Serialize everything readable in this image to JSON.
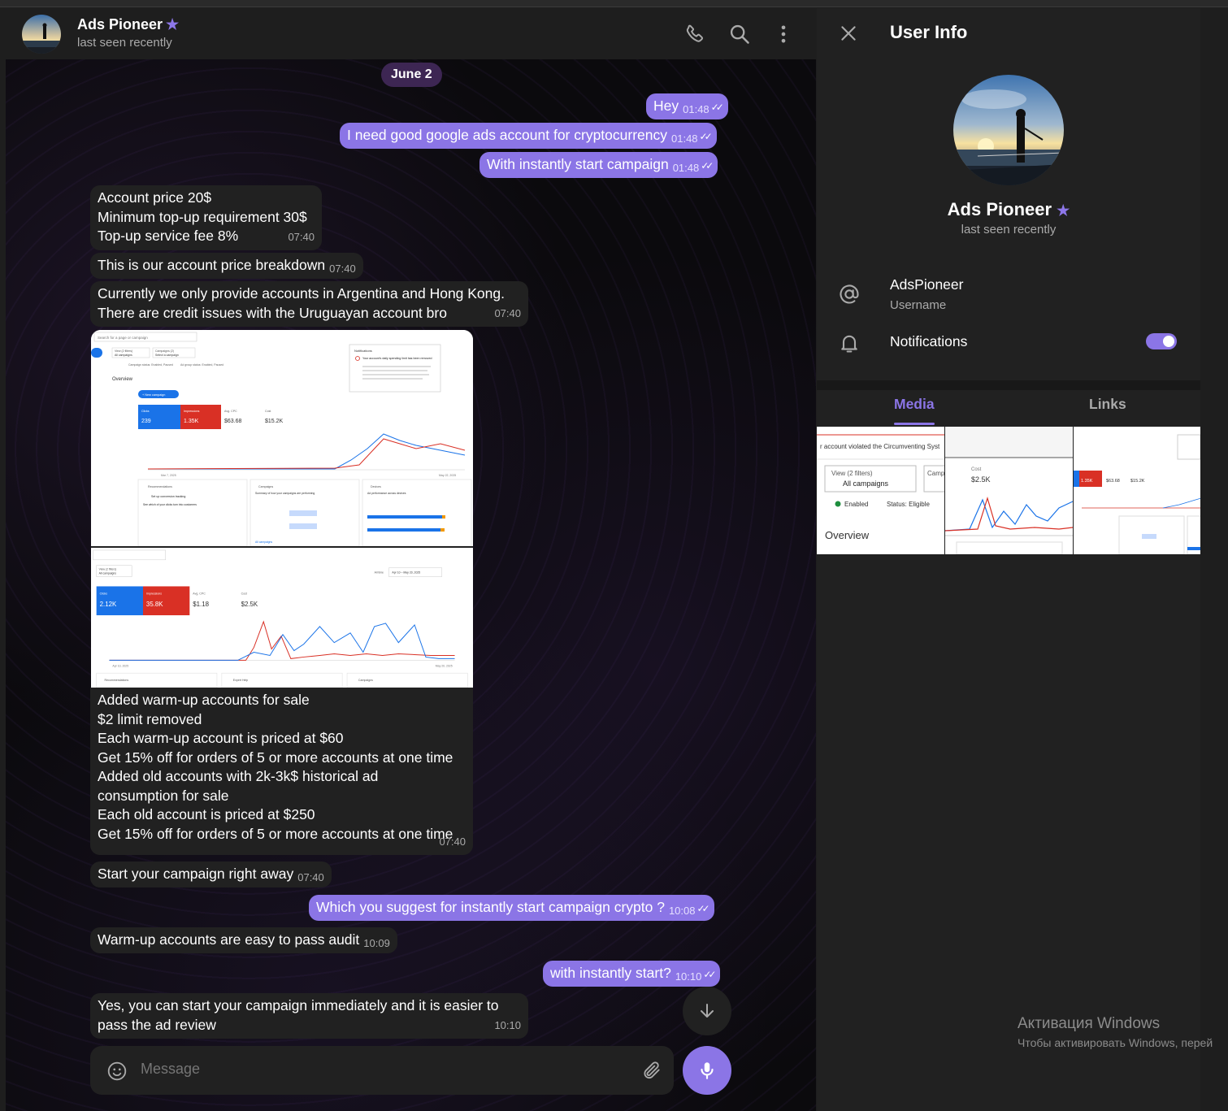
{
  "header": {
    "name": "Ads Pioneer",
    "status": "last seen recently"
  },
  "date_divider": "June 2",
  "messages": [
    {
      "dir": "out",
      "text": "Hey",
      "time": "01:48"
    },
    {
      "dir": "out",
      "text": "I need good google ads account for cryptocurrency",
      "time": "01:48"
    },
    {
      "dir": "out",
      "text": "With instantly start campaign",
      "time": "01:48"
    },
    {
      "dir": "in",
      "lines": [
        "Account price 20$",
        "Minimum top-up requirement 30$",
        "Top-up service fee 8%"
      ],
      "time": "07:40"
    },
    {
      "dir": "in",
      "text": "This is our account price breakdown",
      "time": "07:40"
    },
    {
      "dir": "in",
      "lines": [
        "Currently we only provide accounts in Argentina and Hong Kong.",
        "There are credit issues with the Uruguayan account bro"
      ],
      "time": "07:40"
    },
    {
      "dir": "in",
      "lines": [
        "Added warm-up accounts for sale",
        "$2 limit removed",
        "Each warm-up account is priced at $60",
        "Get 15% off for orders of 5 or more accounts at one time",
        "Added old accounts with 2k-3k$ historical ad",
        "consumption for sale",
        "Each old account is priced at $250",
        "Get 15% off for orders of 5 or more accounts at one time"
      ],
      "time": "07:40"
    },
    {
      "dir": "in",
      "text": "Start your campaign right away",
      "time": "07:40"
    },
    {
      "dir": "out",
      "text": "Which you suggest for instantly start campaign crypto ?",
      "time": "10:08"
    },
    {
      "dir": "in",
      "text": "Warm-up accounts are easy to pass audit",
      "time": "10:09"
    },
    {
      "dir": "out",
      "text": "with instantly start?",
      "time": "10:10"
    },
    {
      "dir": "in",
      "lines": [
        "Yes, you can start your campaign immediately and it is easier to",
        "pass the ad review"
      ],
      "time": "10:10"
    }
  ],
  "screenshot1": {
    "search": "Search for a page or campaign",
    "view": "View (2 filters)",
    "view_sub": "All campaigns",
    "campaigns": "Campaigns (2)",
    "campaigns_sub": "Select a campaign",
    "filters": "Campaign status: Enabled, Paused",
    "filters2": "Ad group status: Enabled, Paused",
    "overview": "Overview",
    "new_campaign": "+ New campaign",
    "clicks_label": "Clicks",
    "clicks": "239",
    "impressions_label": "Impressions",
    "impressions": "1.35K",
    "cpc_label": "Avg. CPC",
    "cpc": "$63.68",
    "cost_label": "Cost",
    "cost": "$15.2K",
    "notif_title": "Notifications",
    "notif_head": "Your account's daily spending limit has been removed",
    "notif_body": "Your account's daily spending limit has been removed. Your daily spend will now be based on the budgets you've set for your campaigns",
    "recs": "Recommendations",
    "rec_item": "Set up conversion tracking",
    "rec_sub": "See which of your clicks turn into customers",
    "camp_panel": "Campaigns",
    "camp_sub": "Summary of how your campaigns are performing",
    "devices": "Devices",
    "devices_sub": "Ad performance across devices",
    "all_campaigns": "All campaigns",
    "chart_left": "Mar 7, 2025",
    "chart_right": "May 22, 2025"
  },
  "screenshot2": {
    "view": "View (2 filters)",
    "view_sub": "All campaigns",
    "range": "Apr 10 – May 20, 2025",
    "range_label": "All time",
    "clicks_label": "Clicks",
    "clicks": "2.12K",
    "impressions_label": "Impressions",
    "impressions": "35.8K",
    "cpc_label": "Avg. CPC",
    "cpc": "$1.18",
    "cost_label": "Cost",
    "cost": "$2.5K",
    "recs": "Recommendations",
    "expert": "Expert Help",
    "camp": "Campaigns",
    "chart_left": "Apr 10, 2025",
    "chart_right": "May 20, 2025"
  },
  "composer": {
    "placeholder": "Message"
  },
  "side": {
    "title": "User Info",
    "name": "Ads Pioneer",
    "status": "last seen recently",
    "username": "AdsPioneer",
    "username_label": "Username",
    "notifications": "Notifications",
    "notifications_on": true,
    "tab_media": "Media",
    "tab_links": "Links",
    "thumb1_text": "r account violated the Circumventing Syst",
    "thumb1_view": "View (2 filters)",
    "thumb1_camp": "All campaigns",
    "thumb1_camp2": "Camp",
    "thumb1_enabled": "Enabled",
    "thumb1_status": "Status: Eligible",
    "thumb1_overview": "Overview",
    "thumb2_cost": "$2.5K",
    "thumb2_cost_label": "Cost",
    "thumb3_a": "1.35K",
    "thumb3_b": "$63.68",
    "thumb3_c": "$15.2K"
  },
  "watermark": {
    "line1": "Активация Windows",
    "line2": "Чтобы активировать Windows, перей"
  },
  "colors": {
    "accent": "#8b75e6",
    "bubble_in": "#212121",
    "panel": "#212121"
  }
}
